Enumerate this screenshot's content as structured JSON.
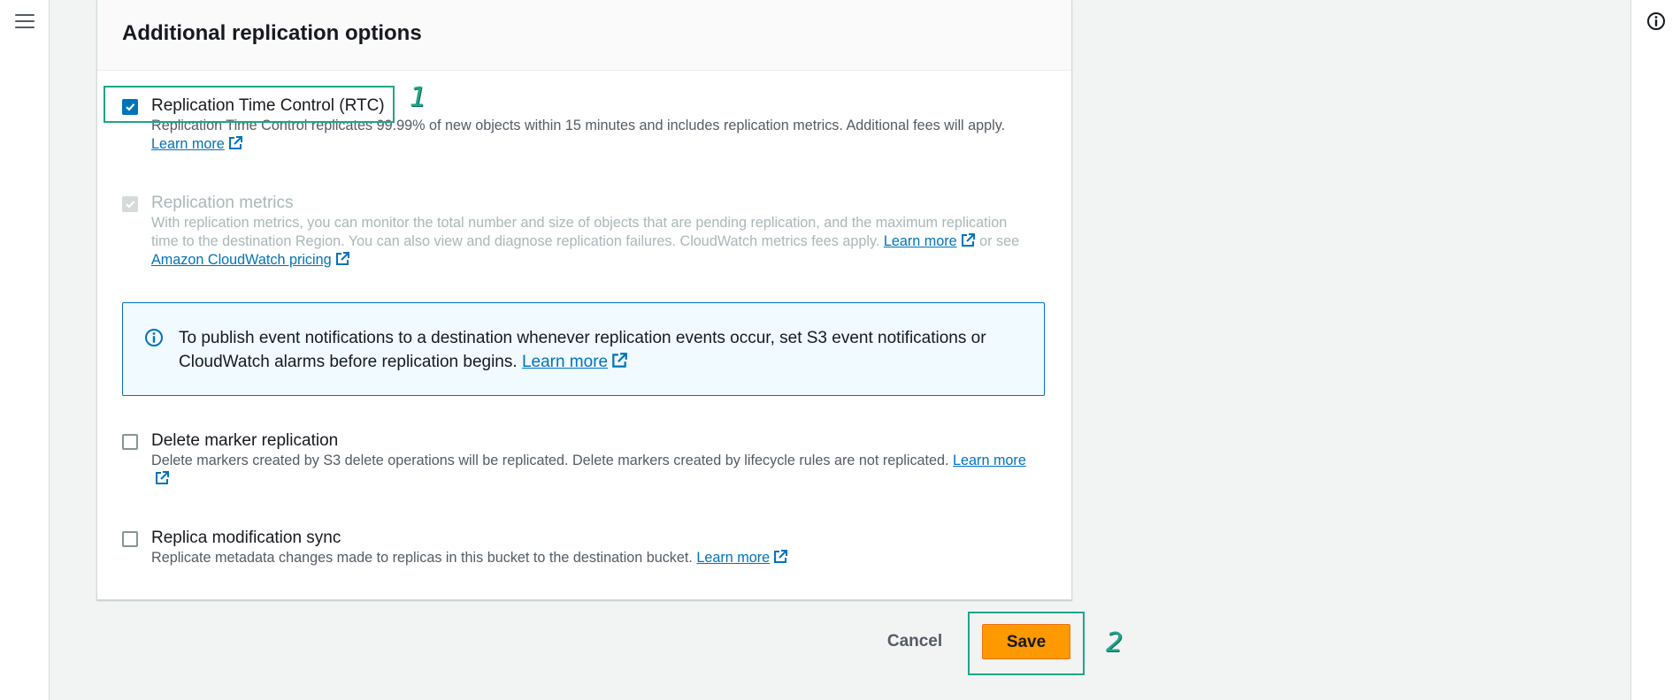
{
  "nav": {
    "menu_icon": "hamburger-menu-icon",
    "info_icon": "info-icon"
  },
  "panel": {
    "title": "Additional replication options"
  },
  "options": {
    "rtc": {
      "label": "Replication Time Control (RTC)",
      "checked": true,
      "desc": "Replication Time Control replicates 99.99% of new objects within 15 minutes and includes replication metrics. Additional fees will apply.",
      "link": "Learn more"
    },
    "metrics": {
      "label": "Replication metrics",
      "checked": true,
      "disabled": true,
      "desc": "With replication metrics, you can monitor the total number and size of objects that are pending replication, and the maximum replication time to the destination Region. You can also view and diagnose replication failures. CloudWatch metrics fees apply.",
      "link": "Learn more",
      "or_see": "or see",
      "link2": "Amazon CloudWatch pricing"
    },
    "delete_marker": {
      "label": "Delete marker replication",
      "checked": false,
      "desc": "Delete markers created by S3 delete operations will be replicated. Delete markers created by lifecycle rules are not replicated.",
      "link": "Learn more"
    },
    "replica_sync": {
      "label": "Replica modification sync",
      "checked": false,
      "desc": "Replicate metadata changes made to replicas in this bucket to the destination bucket.",
      "link": "Learn more"
    }
  },
  "info_box": {
    "text": "To publish event notifications to a destination whenever replication events occur, set S3 event notifications or CloudWatch alarms before replication begins.",
    "link": "Learn more"
  },
  "actions": {
    "cancel": "Cancel",
    "save": "Save"
  },
  "annotations": {
    "marker1": "1",
    "marker2": "2"
  },
  "colors": {
    "accent": "#0073bb",
    "primary_button": "#ff9900",
    "highlight": "#1fa58a"
  }
}
